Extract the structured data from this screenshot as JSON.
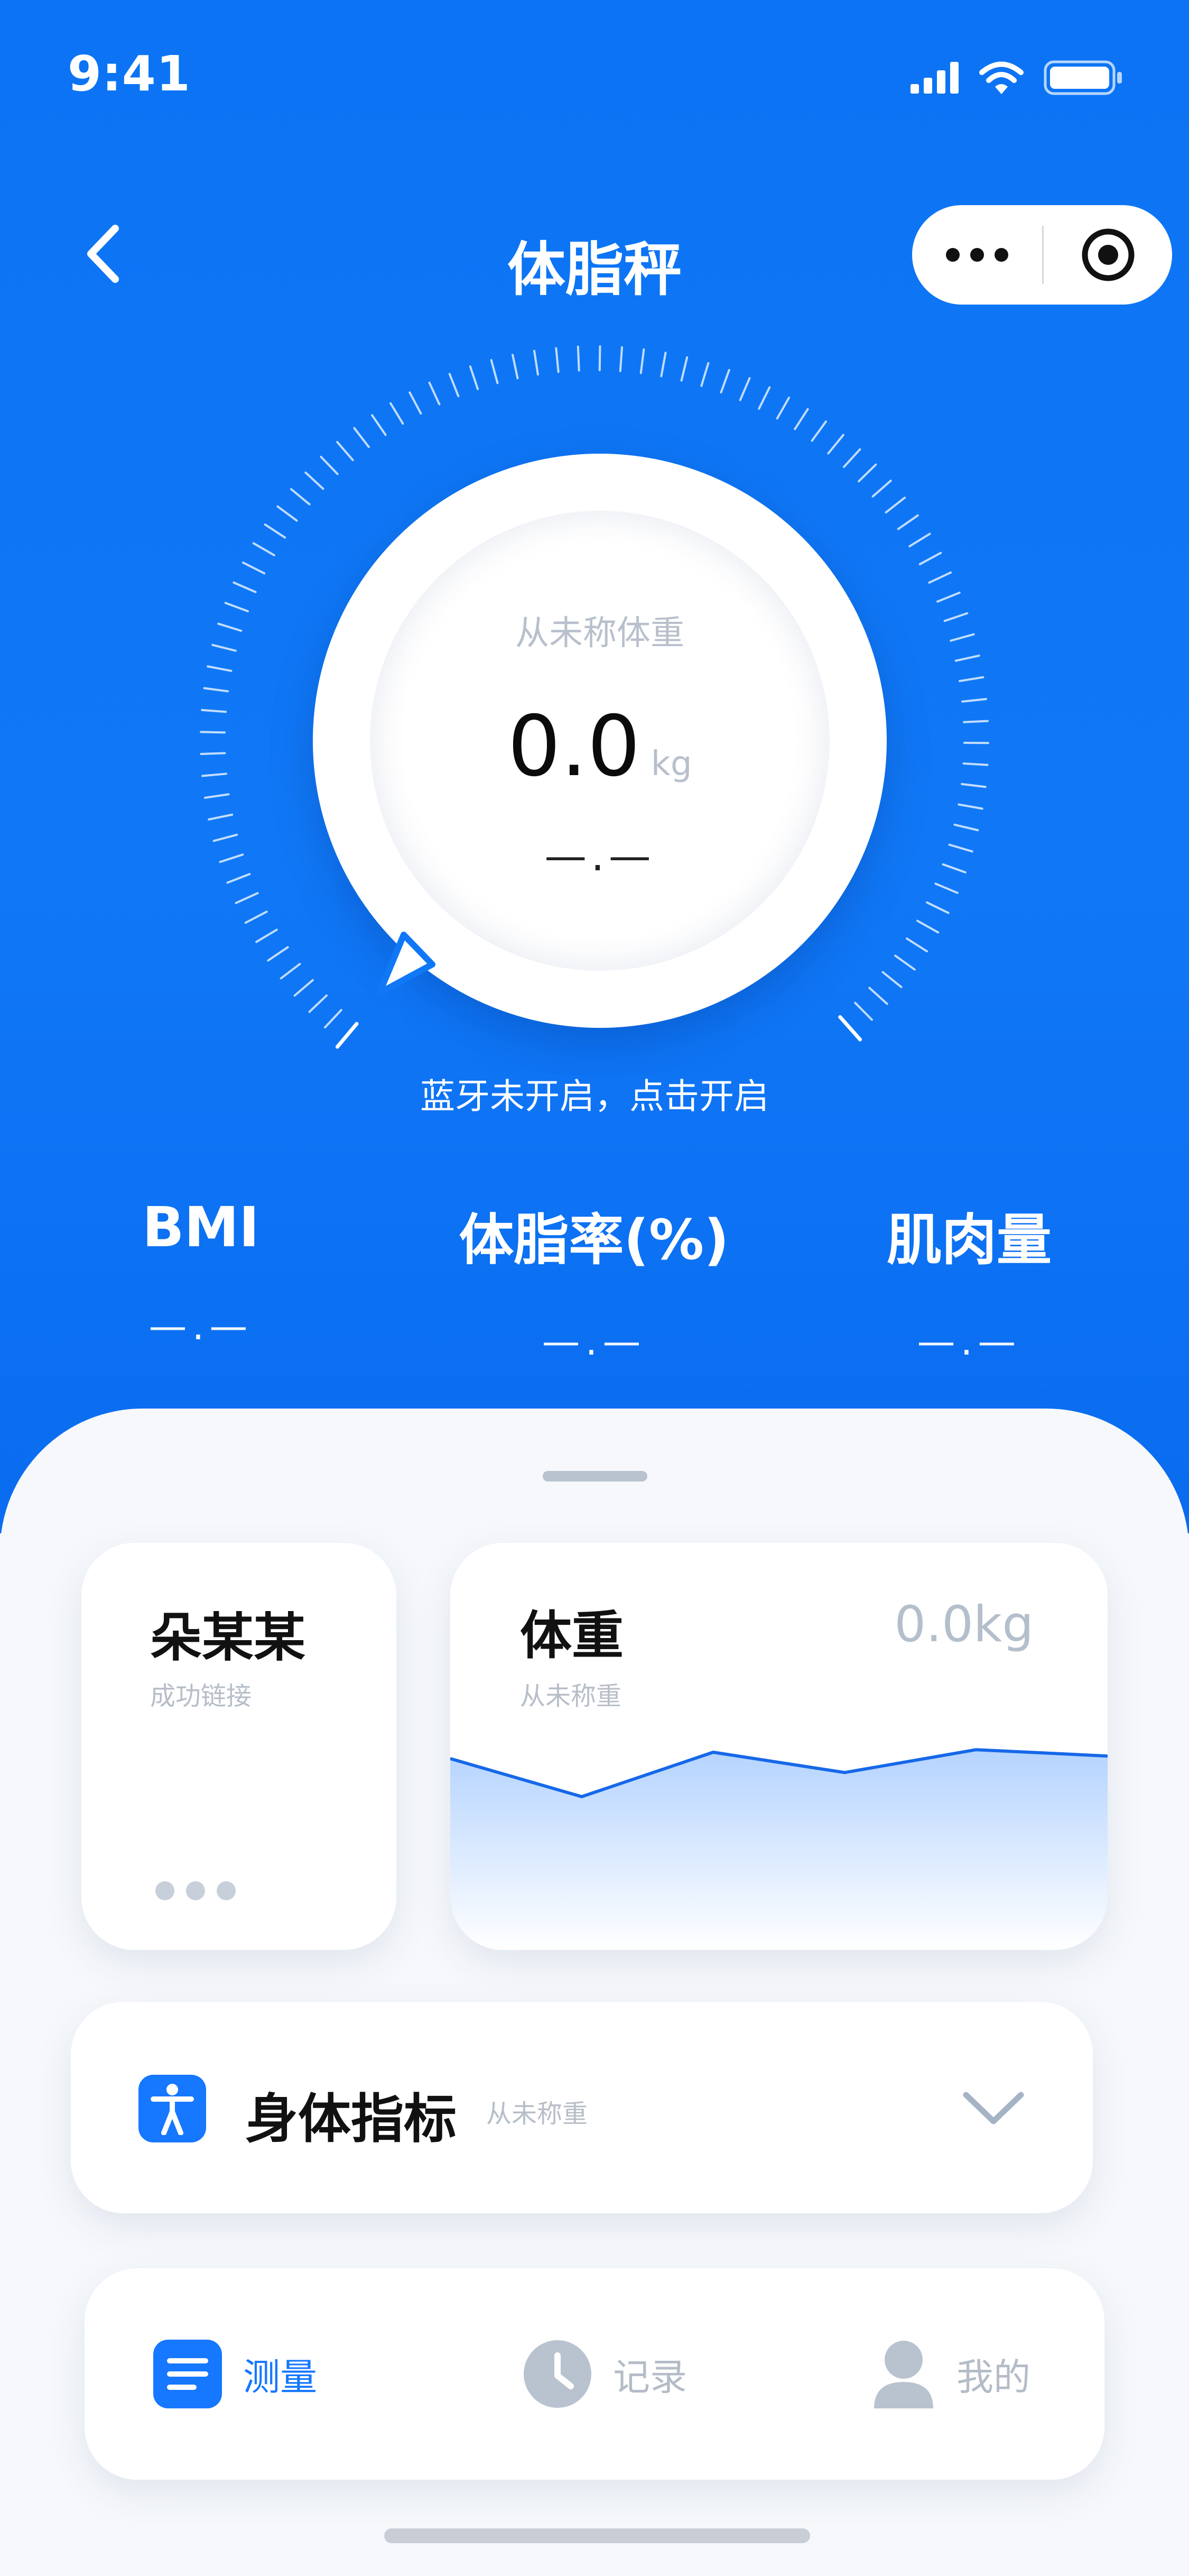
{
  "status_bar": {
    "time": "9:41"
  },
  "nav": {
    "title": "体脂秤"
  },
  "gauge": {
    "hint": "从未称体重",
    "value": "0.0",
    "unit": "kg",
    "sub_value": "—.—",
    "bluetooth_text": "蓝牙未开启，点击开启"
  },
  "metrics": [
    {
      "label": "BMI",
      "value": "—.—"
    },
    {
      "label": "体脂率(%)",
      "value": "—.—"
    },
    {
      "label": "肌肉量",
      "value": "—.—"
    }
  ],
  "device_card": {
    "name": "朵某某",
    "status": "成功链接"
  },
  "weight_card": {
    "title": "体重",
    "subtitle": "从未称重",
    "value": "0.0kg",
    "trend": [
      0.55,
      0.25,
      0.6,
      0.44,
      0.62,
      0.57
    ]
  },
  "body_metrics": {
    "title": "身体指标",
    "subtitle": "从未称重"
  },
  "tabs": [
    {
      "label": "测量",
      "icon": "list-icon",
      "active": true
    },
    {
      "label": "记录",
      "icon": "clock-icon",
      "active": false
    },
    {
      "label": "我的",
      "icon": "user-icon",
      "active": false
    }
  ],
  "colors": {
    "primary": "#1677ff",
    "hero": "#0c74f4",
    "muted": "#b7bec8"
  }
}
